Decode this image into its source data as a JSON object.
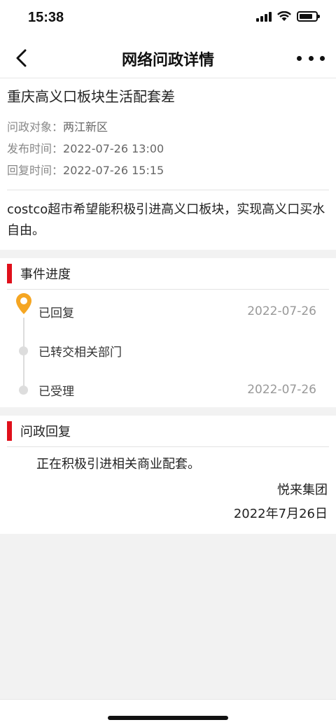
{
  "status_bar": {
    "time": "15:38"
  },
  "nav": {
    "title": "网络问政详情",
    "back_icon": "chevron-left-icon",
    "more_icon": "more-dots-icon"
  },
  "article": {
    "title": "重庆高义口板块生活配套差",
    "meta": [
      {
        "label": "问政对象：",
        "value": "两江新区"
      },
      {
        "label": "发布时间：",
        "value": "2022-07-26 13:00"
      },
      {
        "label": "回复时间：",
        "value": "2022-07-26 15:15"
      }
    ],
    "body": "costco超市希望能积极引进高义口板块，实现高义口买水自由。"
  },
  "progress": {
    "section_title": "事件进度",
    "items": [
      {
        "label": "已回复",
        "date": "2022-07-26",
        "icon": "location-pin-icon"
      },
      {
        "label": "已转交相关部门",
        "date": ""
      },
      {
        "label": "已受理",
        "date": "2022-07-26"
      }
    ]
  },
  "reply": {
    "section_title": "问政回复",
    "text": "正在积极引进相关商业配套。",
    "org": "悦来集团",
    "date": "2022年7月26日"
  },
  "colors": {
    "accent": "#e0101b",
    "pin": "#f5a623",
    "muted": "#999999"
  }
}
